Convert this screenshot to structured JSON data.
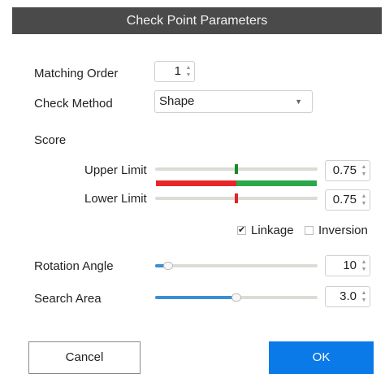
{
  "dialog": {
    "title": "Check Point Parameters",
    "matching_order": {
      "label": "Matching Order",
      "value": "1"
    },
    "check_method": {
      "label": "Check Method",
      "selected": "Shape"
    },
    "score": {
      "label": "Score",
      "upper_limit": {
        "label": "Upper Limit",
        "value": "0.75",
        "level": 0.5
      },
      "lower_limit": {
        "label": "Lower Limit",
        "value": "0.75",
        "level": 0.5
      },
      "range_bar": {
        "reject_fraction": 0.5,
        "reject_color": "#e8262a",
        "accept_color": "#2aa84a"
      },
      "marker_colors": {
        "upper": "#188a2e",
        "lower": "#e0232b"
      }
    },
    "linkage": {
      "label": "Linkage",
      "checked": true
    },
    "inversion": {
      "label": "Inversion",
      "checked": false
    },
    "rotation_angle": {
      "label": "Rotation Angle",
      "value": "10",
      "level": 0.08
    },
    "search_area": {
      "label": "Search Area",
      "value": "3.0",
      "level": 0.5
    },
    "buttons": {
      "cancel": "Cancel",
      "ok": "OK"
    },
    "colors": {
      "titlebar": "#4a4a4a",
      "accent": "#0a7ae8",
      "slider_fill": "#3b8fd4"
    },
    "icons": {
      "spin_up": "▲",
      "spin_down": "▼",
      "dropdown": "▼",
      "check": "✔"
    }
  }
}
